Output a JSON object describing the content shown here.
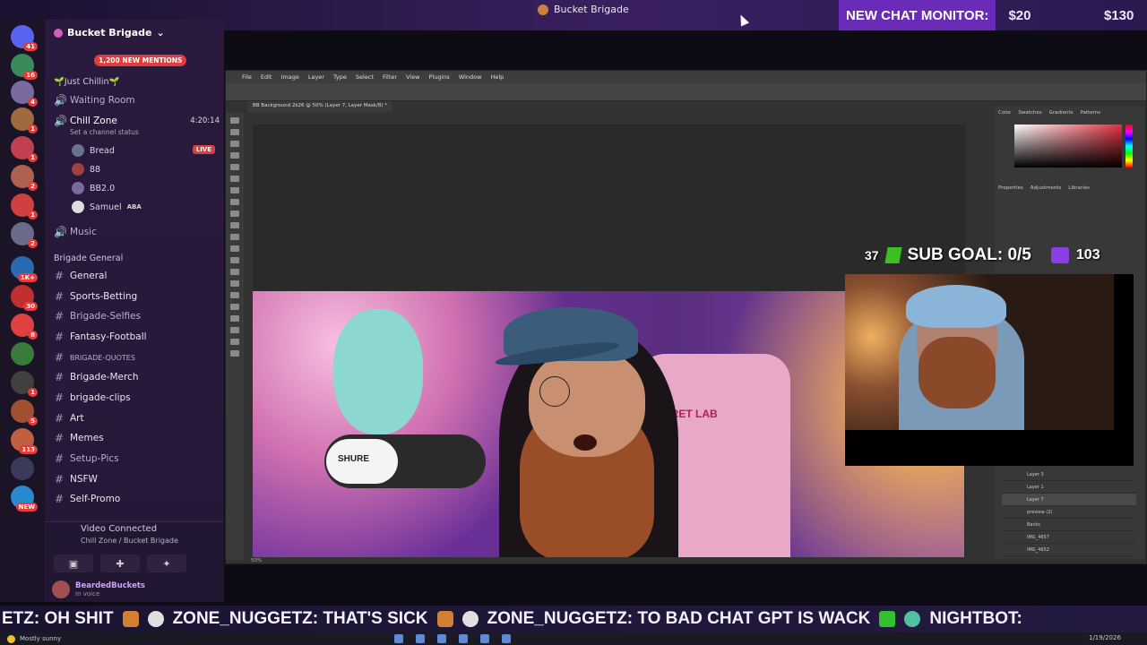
{
  "window": {
    "title": "Bucket Brigade"
  },
  "chat_monitor": {
    "label": "NEW CHAT MONITOR:",
    "amount1": "$20",
    "amount2": "$130"
  },
  "servers": [
    {
      "badge": "41",
      "color": "#5865f2"
    },
    {
      "badge": "16",
      "color": "#3a8a5a"
    },
    {
      "badge": "4",
      "color": "#7a6aa0"
    },
    {
      "badge": "1",
      "color": "#a06a40"
    },
    {
      "badge": "1",
      "color": "#c04050"
    },
    {
      "badge": "2",
      "color": "#b06050"
    },
    {
      "badge": "1",
      "color": "#d04040"
    },
    {
      "badge": "2",
      "color": "#6a6a8a"
    },
    {
      "badge": "1K+",
      "color": "#2a6ab0"
    },
    {
      "badge": "30",
      "color": "#c03030"
    },
    {
      "badge": "8",
      "color": "#e04040"
    },
    {
      "badge": "",
      "color": "#3a7a3a"
    },
    {
      "badge": "1",
      "color": "#404040"
    },
    {
      "badge": "5",
      "color": "#a05030"
    },
    {
      "badge": "113",
      "color": "#c06040"
    },
    {
      "badge": "",
      "color": "#3a3a5a"
    },
    {
      "badge": "NEW",
      "color": "#2a8ad0"
    }
  ],
  "sidebar": {
    "server_name": "Bucket Brigade",
    "mentions": "1,200 NEW MENTIONS",
    "cat1": "🌱Just Chillin🌱",
    "channels_voice": [
      {
        "name": "Waiting Room"
      },
      {
        "name": "Chill Zone",
        "time": "4:20:14",
        "status": "Set a channel status"
      }
    ],
    "users": [
      {
        "name": "Bread",
        "live": "LIVE"
      },
      {
        "name": "88"
      },
      {
        "name": "BB2.0"
      },
      {
        "name": "Samuel",
        "tag": "ABA"
      }
    ],
    "music": "Music",
    "cat2": "Brigade General",
    "text_channels": [
      "General",
      "Sports-Betting",
      "Brigade-Selfies",
      "Fantasy-Football",
      "BRIGADE-QUOTES",
      "Brigade-Merch",
      "brigade-clips",
      "Art",
      "Memes",
      "Setup-Pics",
      "NSFW",
      "Self-Promo"
    ]
  },
  "voice": {
    "connected": "Video Connected",
    "location": "Chill Zone / Bucket Brigade"
  },
  "userbar": {
    "name": "BeardedBuckets",
    "status": "In voice"
  },
  "photoshop": {
    "menu": [
      "File",
      "Edit",
      "Image",
      "Layer",
      "Type",
      "Select",
      "Filter",
      "View",
      "Plugins",
      "Window",
      "Help"
    ],
    "doc_tab": "BB Background 2k26 @ 50% (Layer 7, Layer Mask/8) *",
    "zoom": "50%",
    "panel_tabs": [
      "Color",
      "Swatches",
      "Gradients",
      "Patterns"
    ],
    "props_tabs": [
      "Properties",
      "Adjustments",
      "Libraries"
    ],
    "layers": [
      "Layer 3",
      "Layer 1",
      "Layer 7",
      "preview (2)",
      "Backs",
      "IMG_4657",
      "IMG_4652"
    ]
  },
  "photo": {
    "mic_brand": "SHURE",
    "chair_text": "ECRET LAB"
  },
  "sub_goal": {
    "count": "37",
    "label": "SUB GOAL: 0/5",
    "followers": "103"
  },
  "ticker": {
    "items": [
      "ETZ: OH SHIT",
      "ZONE_NUGGETZ: THAT'S SICK",
      "ZONE_NUGGETZ: TO BAD CHAT GPT IS WACK",
      "NIGHTBOT:"
    ]
  },
  "taskbar": {
    "weather": "Mostly sunny",
    "date": "1/19/2026"
  }
}
